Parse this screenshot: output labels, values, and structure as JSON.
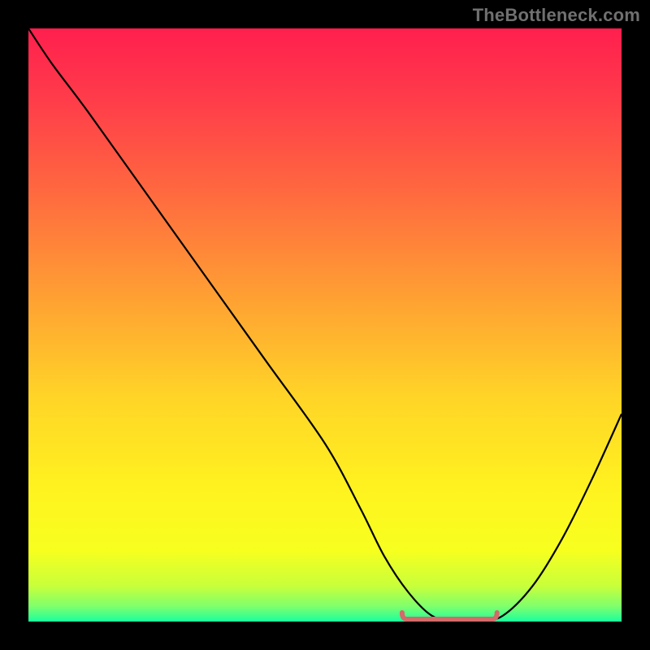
{
  "watermark": "TheBottleneck.com",
  "gradient_stops": [
    {
      "offset": 0.0,
      "color": "#ff1f4e"
    },
    {
      "offset": 0.12,
      "color": "#ff3c4a"
    },
    {
      "offset": 0.28,
      "color": "#ff6a3f"
    },
    {
      "offset": 0.45,
      "color": "#ff9f33"
    },
    {
      "offset": 0.62,
      "color": "#ffd427"
    },
    {
      "offset": 0.78,
      "color": "#fff31f"
    },
    {
      "offset": 0.88,
      "color": "#f7ff1f"
    },
    {
      "offset": 0.94,
      "color": "#c8ff3a"
    },
    {
      "offset": 0.975,
      "color": "#7dff6e"
    },
    {
      "offset": 1.0,
      "color": "#1aff9e"
    }
  ],
  "curve_stroke": "#000000",
  "curve_width": 2.2,
  "marker_stroke": "#d46a6a",
  "marker_width": 6,
  "chart_data": {
    "type": "line",
    "title": "",
    "xlabel": "",
    "ylabel": "",
    "xlim": [
      0,
      100
    ],
    "ylim": [
      0,
      100
    ],
    "x": [
      0,
      4,
      10,
      20,
      30,
      40,
      50,
      56,
      60,
      64,
      68,
      72,
      76,
      80,
      85,
      90,
      95,
      100
    ],
    "values": [
      100,
      94,
      86,
      72,
      58,
      44,
      30,
      19,
      11,
      5,
      1,
      0,
      0,
      1,
      6,
      14,
      24,
      35
    ],
    "annotations": [
      {
        "kind": "flat-marker",
        "x_start": 63,
        "x_end": 79,
        "y": 0
      }
    ]
  }
}
